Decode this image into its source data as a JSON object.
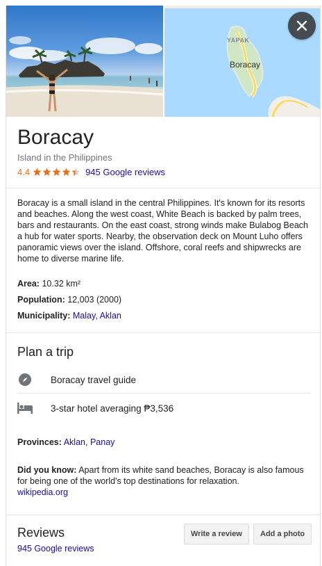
{
  "hero": {
    "map_labels": {
      "north": "YAPAK",
      "place": "Boracay"
    }
  },
  "place": {
    "title": "Boracay",
    "subtitle": "Island in the Philippines",
    "rating": "4.4",
    "stars": 4.4,
    "reviews_link": "945 Google reviews"
  },
  "description": "Boracay is a small island in the central Philippines. It's known for its resorts and beaches. Along the west coast, White Beach is backed by palm trees, bars and restaurants. On the east coast, strong winds make Bulabog Beach a hub for water sports. Nearby, the observation deck on Mount Luho offers panoramic views over the island. Offshore, coral reefs and shipwrecks are home to diverse marine life.",
  "facts": {
    "area_label": "Area:",
    "area_value": "10.32 km²",
    "population_label": "Population:",
    "population_value": "12,003 (2000)",
    "municipality_label": "Municipality:",
    "municipality_links": [
      "Malay",
      "Aklan"
    ]
  },
  "plan_trip": {
    "title": "Plan a trip",
    "items": [
      {
        "label": "Boracay travel guide",
        "icon": "compass-icon"
      },
      {
        "label": "3-star hotel averaging ₱3,536",
        "icon": "bed-icon"
      }
    ]
  },
  "provinces": {
    "label": "Provinces:",
    "links": [
      "Aklan",
      "Panay"
    ]
  },
  "did_you_know": {
    "label": "Did you know:",
    "text": "Apart from its white sand beaches, Boracay is also famous for being one of the world's top destinations for relaxation.",
    "source": "wikipedia.org"
  },
  "reviews": {
    "title": "Reviews",
    "link": "945 Google reviews",
    "write_button": "Write a review",
    "photo_button": "Add a photo"
  },
  "colors": {
    "link": "#1a0dab",
    "rating": "#e7711b",
    "map_water": "#aadaff",
    "road": "#fbd95a"
  }
}
